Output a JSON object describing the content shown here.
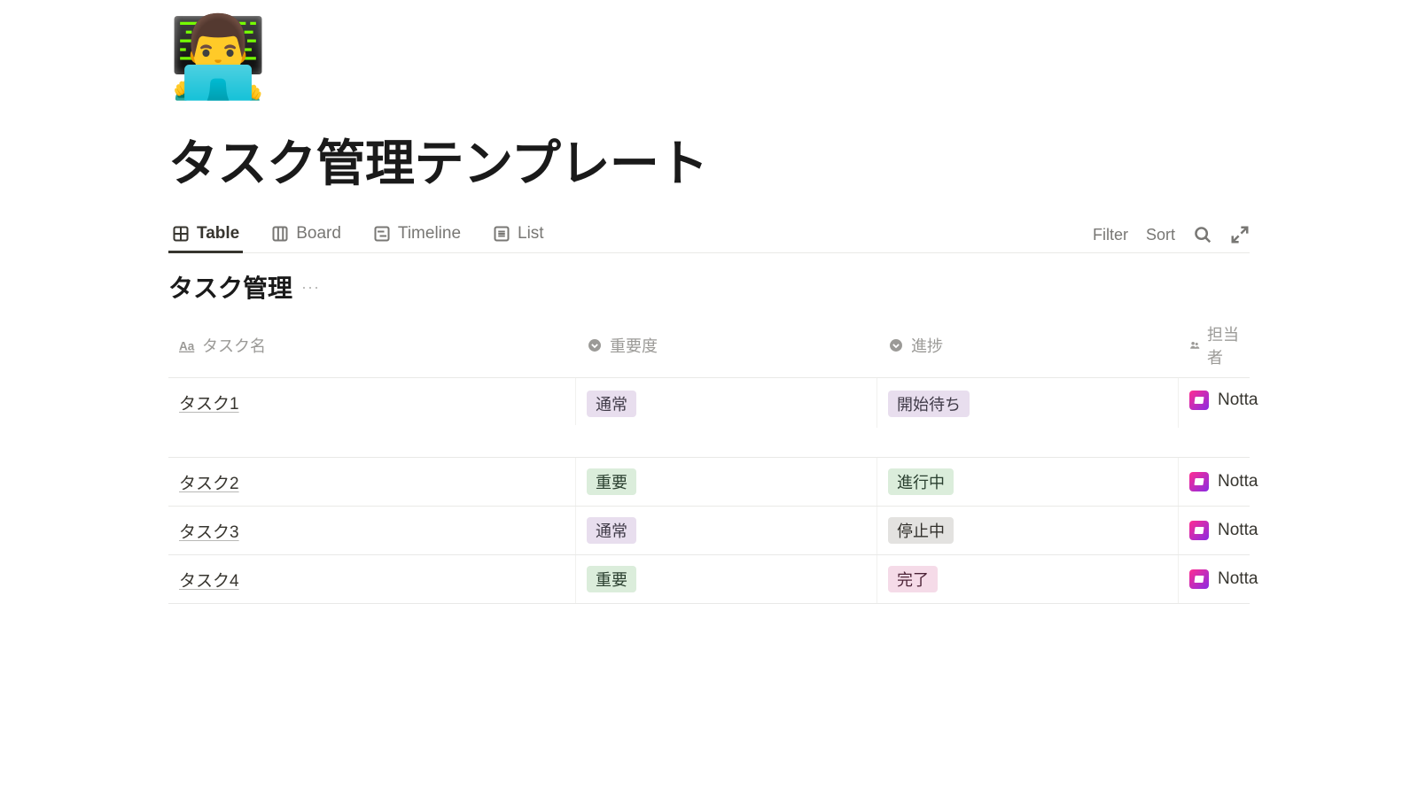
{
  "page": {
    "icon": "👨‍💻",
    "title": "タスク管理テンプレート"
  },
  "views": {
    "tabs": [
      {
        "label": "Table",
        "icon": "table-icon",
        "active": true
      },
      {
        "label": "Board",
        "icon": "board-icon",
        "active": false
      },
      {
        "label": "Timeline",
        "icon": "timeline-icon",
        "active": false
      },
      {
        "label": "List",
        "icon": "list-icon",
        "active": false
      }
    ],
    "actions": {
      "filter": "Filter",
      "sort": "Sort"
    }
  },
  "database": {
    "title": "タスク管理",
    "columns": [
      {
        "label": "タスク名",
        "type": "title"
      },
      {
        "label": "重要度",
        "type": "select"
      },
      {
        "label": "進捗",
        "type": "select"
      },
      {
        "label": "担当者",
        "type": "person"
      }
    ],
    "rows": [
      {
        "name": "タスク1",
        "priority": {
          "text": "通常",
          "color": "purple"
        },
        "status": {
          "text": "開始待ち",
          "color": "purple"
        },
        "assignee": "Notta",
        "tall": true
      },
      {
        "name": "タスク2",
        "priority": {
          "text": "重要",
          "color": "green"
        },
        "status": {
          "text": "進行中",
          "color": "green"
        },
        "assignee": "Notta"
      },
      {
        "name": "タスク3",
        "priority": {
          "text": "通常",
          "color": "purple"
        },
        "status": {
          "text": "停止中",
          "color": "gray"
        },
        "assignee": "Notta"
      },
      {
        "name": "タスク4",
        "priority": {
          "text": "重要",
          "color": "green"
        },
        "status": {
          "text": "完了",
          "color": "pink"
        },
        "assignee": "Notta"
      }
    ]
  }
}
